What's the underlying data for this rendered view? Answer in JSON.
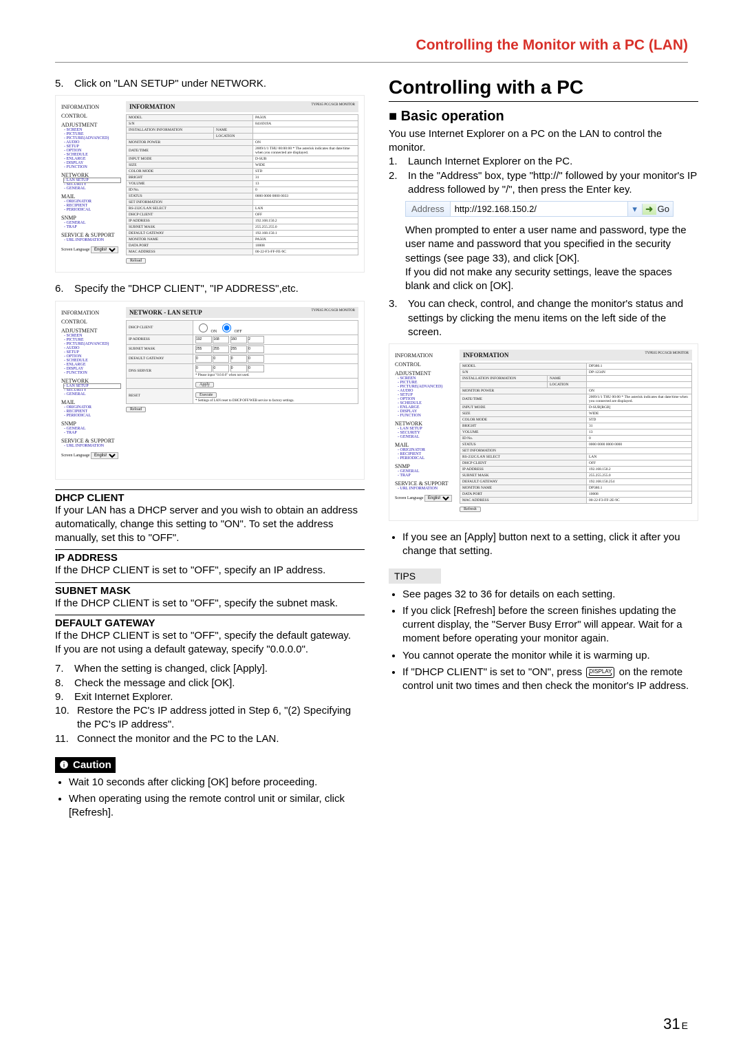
{
  "header": {
    "title": "Controlling the Monitor with a PC (LAN)"
  },
  "left": {
    "step5": {
      "num": "5.",
      "text": "Click on \"LAN SETUP\" under NETWORK."
    },
    "step6": {
      "num": "6.",
      "text": "Specify the \"DHCP CLIENT\", \"IP ADDRESS\",etc."
    },
    "dhcp": {
      "t1": "DHCP CLIENT",
      "p1": "If your LAN has a DHCP server and you wish to obtain an address automatically, change this setting to \"ON\". To set the address manually, set this to \"OFF\".",
      "t2": "IP ADDRESS",
      "p2": "If the DHCP CLIENT is set to \"OFF\", specify an IP address.",
      "t3": "SUBNET MASK",
      "p3": "If the DHCP CLIENT is set to \"OFF\", specify the subnet mask.",
      "t4": "DEFAULT GATEWAY",
      "p4a": "If the DHCP CLIENT is set to \"OFF\", specify the default gateway.",
      "p4b": "If you are not using a default gateway, specify \"0.0.0.0\"."
    },
    "steps_after": {
      "s7": {
        "num": "7.",
        "text": "When the setting is changed, click [Apply]."
      },
      "s8": {
        "num": "8.",
        "text": "Check the message and click [OK]."
      },
      "s9": {
        "num": "9.",
        "text": "Exit Internet Explorer."
      },
      "s10": {
        "num": "10.",
        "text": "Restore the PC's IP address jotted in Step 6, \"(2) Specifying the PC's IP address\"."
      },
      "s11": {
        "num": "11.",
        "text": "Connect the monitor and the PC to the LAN."
      }
    },
    "caution": {
      "title": "Caution",
      "b1": "Wait 10 seconds after clicking [OK] before proceeding.",
      "b2": "When operating using the remote control unit or similar, click [Refresh]."
    },
    "capture1": {
      "title": "INFORMATION",
      "sub": "TYPE65\nPCC/SCB\nMONITOR",
      "reload": "Reload",
      "rows": [
        [
          "MODEL",
          "",
          "PA50X"
        ],
        [
          "S/N",
          "",
          "8416919A"
        ],
        [
          "INSTALLATION INFORMATION",
          "NAME",
          ""
        ],
        [
          "",
          "LOCATION",
          ""
        ],
        [
          "MONITOR POWER",
          "",
          "ON"
        ],
        [
          "DATE/TIME",
          "",
          "2009/1/1 THU 00:00:00\n* The asterisk indicates that date/time when you connected are displayed."
        ],
        [
          "INPUT MODE",
          "",
          "D-SUB"
        ],
        [
          "SIZE",
          "",
          "WIDE"
        ],
        [
          "COLOR MODE",
          "",
          "STD"
        ],
        [
          "BRIGHT",
          "",
          "31"
        ],
        [
          "VOLUME",
          "",
          "13"
        ],
        [
          "ID No.",
          "",
          "0"
        ],
        [
          "STATUS",
          "",
          "0000 0000 0000 0033"
        ],
        [
          "SET INFORMATION",
          "",
          ""
        ],
        [
          "RS-232C/LAN SELECT",
          "",
          "LAN"
        ],
        [
          "DHCP CLIENT",
          "",
          "OFF"
        ],
        [
          "IP ADDRESS",
          "",
          "192.168.150.2"
        ],
        [
          "SUBNET MASK",
          "",
          "255.255.255.0"
        ],
        [
          "DEFAULT GATEWAY",
          "",
          "192.168.150.1"
        ],
        [
          "MONITOR NAME",
          "",
          "PA50X"
        ],
        [
          "DATA PORT",
          "",
          "10008"
        ],
        [
          "MAC ADDRESS",
          "",
          "00-22-F3-FF-FE-9C"
        ]
      ]
    },
    "capture2": {
      "title": "NETWORK - LAN SETUP",
      "sub": "TYPE65\nPCC/SCB\nMONITOR",
      "reload": "Reload",
      "rows": [
        [
          "DHCP CLIENT",
          "radio",
          "ON",
          "OFF"
        ],
        [
          "IP ADDRESS",
          "ip",
          "192",
          "168",
          "150",
          "2"
        ],
        [
          "SUBNET MASK",
          "ip",
          "255",
          "255",
          "255",
          "0"
        ],
        [
          "DEFAULT GATEWAY",
          "ip",
          "0",
          "0",
          "0",
          "0"
        ],
        [
          "DNS SERVER",
          "ip",
          "0",
          "0",
          "0",
          "0"
        ]
      ],
      "dns_note": "* Please input \"0.0.0.0\" when not used.",
      "apply": "Apply",
      "reset": "RESET",
      "execute": "Execute",
      "reset_note": "* Settings of LAN reset to DHCP OFF/WEB service to factory settings."
    },
    "nav": {
      "groups": [
        {
          "title": "INFORMATION",
          "items": []
        },
        {
          "title": "CONTROL",
          "items": []
        },
        {
          "title": "ADJUSTMENT",
          "items": [
            "SCREEN",
            "PICTURE",
            "PICTURE(ADVANCED)",
            "AUDIO",
            "SETUP",
            "OPTION",
            "SCHEDULE",
            "ENLARGE",
            "DISPLAY",
            "FUNCTION"
          ]
        },
        {
          "title": "NETWORK",
          "items": [
            "LAN SETUP",
            "SECURITY",
            "GENERAL"
          ]
        },
        {
          "title": "MAIL",
          "items": [
            "ORIGINATOR",
            "RECIPIENT",
            "PERIODICAL"
          ]
        },
        {
          "title": "SNMP",
          "items": [
            "GENERAL",
            "TRAP"
          ]
        },
        {
          "title": "SERVICE & SUPPORT",
          "items": [
            "URL INFORMATION"
          ]
        }
      ],
      "lang_label": "Screen Language",
      "lang_value": "English"
    }
  },
  "right": {
    "h1": "Controlling with a PC",
    "h2": "■ Basic operation",
    "intro": "You use Internet Explorer on a PC on the LAN  to control the monitor.",
    "s1": {
      "num": "1.",
      "text": "Launch Internet Explorer on the PC."
    },
    "s2": {
      "num": "2.",
      "text": "In the \"Address\" box, type \"http://\" followed by your monitor's IP address followed by \"/\", then press the Enter key."
    },
    "addr": {
      "label": "Address",
      "value": "http://192.168.150.2/",
      "go": "Go"
    },
    "after_addr_a": "When prompted to enter a user name and password, type the user name and password that you specified in the security settings (see page 33), and click [OK].",
    "after_addr_b": "If you did not make any security settings, leave the spaces blank and click on [OK].",
    "s3": {
      "num": "3.",
      "text": "You can check, control, and change the monitor's status and settings by clicking the menu items on the left side of the screen."
    },
    "capture3": {
      "title": "INFORMATION",
      "sub": "TYPE65\nPCC/SCB\nMONITOR",
      "rows": [
        [
          "MODEL",
          "",
          "DP380.1"
        ],
        [
          "S/N",
          "",
          "DP-1234N"
        ],
        [
          "INSTALLATION INFORMATION",
          "NAME",
          ""
        ],
        [
          "",
          "LOCATION",
          ""
        ],
        [
          "MONITOR POWER",
          "",
          "ON"
        ],
        [
          "DATE/TIME",
          "",
          "2009/1/1 THU 00:00\n* The asterisk indicates that date/time when you connected are displayed."
        ],
        [
          "INPUT MODE",
          "",
          "D-SUB[RGB]"
        ],
        [
          "SIZE",
          "",
          "WIDE"
        ],
        [
          "COLOR MODE",
          "",
          "STD"
        ],
        [
          "BRIGHT",
          "",
          "31"
        ],
        [
          "VOLUME",
          "",
          "13"
        ],
        [
          "ID No.",
          "",
          "0"
        ],
        [
          "STATUS",
          "",
          "0000 0000 0000 0000"
        ],
        [
          "SET INFORMATION",
          "",
          ""
        ],
        [
          "RS-232C/LAN SELECT",
          "",
          "LAN"
        ],
        [
          "DHCP CLIENT",
          "",
          "OFF"
        ],
        [
          "IP ADDRESS",
          "",
          "192.168.150.2"
        ],
        [
          "SUBNET MASK",
          "",
          "255.255.255.0"
        ],
        [
          "DEFAULT GATEWAY",
          "",
          "192.168.150.254"
        ],
        [
          "MONITOR NAME",
          "",
          "DP380.1"
        ],
        [
          "DATA PORT",
          "",
          "10008"
        ],
        [
          "MAC ADDRESS",
          "",
          "00-22-F3-FF-2E-9C"
        ]
      ],
      "refresh": "Refresh"
    },
    "apply_note": "If you see an [Apply] button next to a setting, click it after you change that setting.",
    "tips": {
      "title": "TIPS",
      "b1": "See pages 32 to 36 for details on each setting.",
      "b2": "If you click [Refresh] before the screen finishes updating the current display, the \"Server Busy Error\" will appear. Wait for a moment before operating your monitor again.",
      "b3": "You cannot operate the monitor while it is warming up.",
      "b4a": "If \"DHCP CLIENT\" is set to \"ON\", press ",
      "b4_btn": "DISPLAY",
      "b4b": " on the remote control unit two times and then check the monitor's IP address."
    }
  },
  "footer": {
    "page": "31",
    "suffix": "E"
  }
}
